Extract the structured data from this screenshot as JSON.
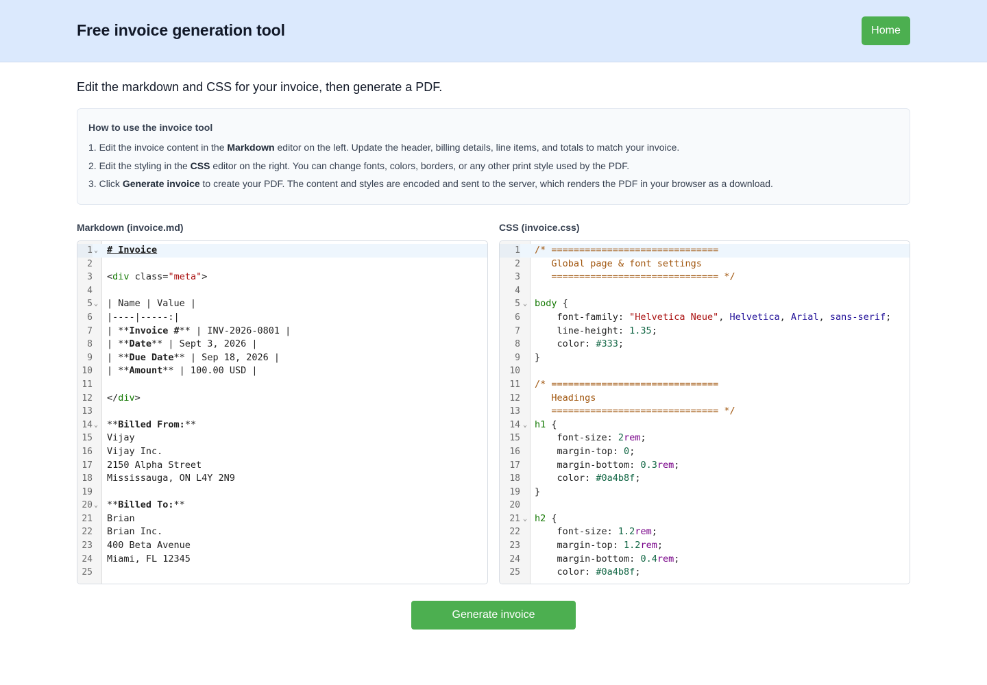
{
  "header": {
    "title": "Free invoice generation tool",
    "home_label": "Home"
  },
  "intro": "Edit the markdown and CSS for your invoice, then generate a PDF.",
  "instructions": {
    "title": "How to use the invoice tool",
    "steps": [
      {
        "n": "1. ",
        "pre": "Edit the invoice content in the ",
        "bold": "Markdown",
        "post": " editor on the left. Update the header, billing details, line items, and totals to match your invoice."
      },
      {
        "n": "2. ",
        "pre": "Edit the styling in the ",
        "bold": "CSS",
        "post": " editor on the right. You can change fonts, colors, borders, or any other print style used by the PDF."
      },
      {
        "n": "3. ",
        "pre": "Click ",
        "bold": "Generate invoice",
        "post": " to create your PDF. The content and styles are encoded and sent to the server, which renders the PDF in your browser as a download."
      }
    ]
  },
  "markdown_editor": {
    "label": "Markdown (invoice.md)",
    "lines": [
      {
        "fold": true,
        "active": true,
        "tokens": [
          [
            "head",
            "# Invoice"
          ]
        ]
      },
      {
        "tokens": []
      },
      {
        "tokens": [
          [
            "",
            "<"
          ],
          [
            "tag",
            "div"
          ],
          [
            "",
            " class="
          ],
          [
            "str",
            "\"meta\""
          ],
          [
            "",
            ">"
          ]
        ]
      },
      {
        "tokens": []
      },
      {
        "fold": true,
        "tokens": [
          [
            "",
            "| Name | Value |"
          ]
        ]
      },
      {
        "tokens": [
          [
            "",
            "|----|-----:|"
          ]
        ]
      },
      {
        "tokens": [
          [
            "",
            "| **"
          ],
          [
            "bold",
            "Invoice #"
          ],
          [
            "",
            "** | INV-2026-0801 |"
          ]
        ]
      },
      {
        "tokens": [
          [
            "",
            "| **"
          ],
          [
            "bold",
            "Date"
          ],
          [
            "",
            "** | Sept 3, 2026 |"
          ]
        ]
      },
      {
        "tokens": [
          [
            "",
            "| **"
          ],
          [
            "bold",
            "Due Date"
          ],
          [
            "",
            "** | Sep 18, 2026 |"
          ]
        ]
      },
      {
        "tokens": [
          [
            "",
            "| **"
          ],
          [
            "bold",
            "Amount"
          ],
          [
            "",
            "** | 100.00 USD |"
          ]
        ]
      },
      {
        "tokens": []
      },
      {
        "tokens": [
          [
            "",
            "</"
          ],
          [
            "tag",
            "div"
          ],
          [
            "",
            ">"
          ]
        ]
      },
      {
        "tokens": []
      },
      {
        "fold": true,
        "tokens": [
          [
            "",
            "**"
          ],
          [
            "bold",
            "Billed From:"
          ],
          [
            "",
            "**"
          ]
        ]
      },
      {
        "tokens": [
          [
            "",
            "Vijay"
          ]
        ]
      },
      {
        "tokens": [
          [
            "",
            "Vijay Inc."
          ]
        ]
      },
      {
        "tokens": [
          [
            "",
            "2150 Alpha Street"
          ]
        ]
      },
      {
        "tokens": [
          [
            "",
            "Mississauga, ON L4Y 2N9"
          ]
        ]
      },
      {
        "tokens": []
      },
      {
        "fold": true,
        "tokens": [
          [
            "",
            "**"
          ],
          [
            "bold",
            "Billed To:"
          ],
          [
            "",
            "**"
          ]
        ]
      },
      {
        "tokens": [
          [
            "",
            "Brian"
          ]
        ]
      },
      {
        "tokens": [
          [
            "",
            "Brian Inc."
          ]
        ]
      },
      {
        "tokens": [
          [
            "",
            "400 Beta Avenue"
          ]
        ]
      },
      {
        "tokens": [
          [
            "",
            "Miami, FL 12345"
          ]
        ]
      },
      {
        "tokens": []
      }
    ]
  },
  "css_editor": {
    "label": "CSS (invoice.css)",
    "lines": [
      {
        "active": true,
        "tokens": [
          [
            "cmt",
            "/* =============================="
          ]
        ]
      },
      {
        "tokens": [
          [
            "cmt",
            "   Global page & font settings"
          ]
        ]
      },
      {
        "tokens": [
          [
            "cmt",
            "   ============================== */"
          ]
        ]
      },
      {
        "tokens": []
      },
      {
        "fold": true,
        "tokens": [
          [
            "sel",
            "body"
          ],
          [
            "",
            " {"
          ]
        ]
      },
      {
        "tokens": [
          [
            "",
            "    font-family: "
          ],
          [
            "str",
            "\"Helvetica Neue\""
          ],
          [
            "",
            ", "
          ],
          [
            "kw",
            "Helvetica"
          ],
          [
            "",
            ", "
          ],
          [
            "kw",
            "Arial"
          ],
          [
            "",
            ", "
          ],
          [
            "kw",
            "sans-serif"
          ],
          [
            "",
            ";"
          ]
        ]
      },
      {
        "tokens": [
          [
            "",
            "    line-height: "
          ],
          [
            "num",
            "1.35"
          ],
          [
            "",
            ";"
          ]
        ]
      },
      {
        "tokens": [
          [
            "",
            "    color: "
          ],
          [
            "num",
            "#333"
          ],
          [
            "",
            ";"
          ]
        ]
      },
      {
        "tokens": [
          [
            "",
            "}"
          ]
        ]
      },
      {
        "tokens": []
      },
      {
        "tokens": [
          [
            "cmt",
            "/* =============================="
          ]
        ]
      },
      {
        "tokens": [
          [
            "cmt",
            "   Headings"
          ]
        ]
      },
      {
        "tokens": [
          [
            "cmt",
            "   ============================== */"
          ]
        ]
      },
      {
        "fold": true,
        "tokens": [
          [
            "sel",
            "h1"
          ],
          [
            "",
            " {"
          ]
        ]
      },
      {
        "tokens": [
          [
            "",
            "    font-size: "
          ],
          [
            "num",
            "2"
          ],
          [
            "unit",
            "rem"
          ],
          [
            "",
            ";"
          ]
        ]
      },
      {
        "tokens": [
          [
            "",
            "    margin-top: "
          ],
          [
            "num",
            "0"
          ],
          [
            "",
            ";"
          ]
        ]
      },
      {
        "tokens": [
          [
            "",
            "    margin-bottom: "
          ],
          [
            "num",
            "0.3"
          ],
          [
            "unit",
            "rem"
          ],
          [
            "",
            ";"
          ]
        ]
      },
      {
        "tokens": [
          [
            "",
            "    color: "
          ],
          [
            "num",
            "#0a4b8f"
          ],
          [
            "",
            ";"
          ]
        ]
      },
      {
        "tokens": [
          [
            "",
            "}"
          ]
        ]
      },
      {
        "tokens": []
      },
      {
        "fold": true,
        "tokens": [
          [
            "sel",
            "h2"
          ],
          [
            "",
            " {"
          ]
        ]
      },
      {
        "tokens": [
          [
            "",
            "    font-size: "
          ],
          [
            "num",
            "1.2"
          ],
          [
            "unit",
            "rem"
          ],
          [
            "",
            ";"
          ]
        ]
      },
      {
        "tokens": [
          [
            "",
            "    margin-top: "
          ],
          [
            "num",
            "1.2"
          ],
          [
            "unit",
            "rem"
          ],
          [
            "",
            ";"
          ]
        ]
      },
      {
        "tokens": [
          [
            "",
            "    margin-bottom: "
          ],
          [
            "num",
            "0.4"
          ],
          [
            "unit",
            "rem"
          ],
          [
            "",
            ";"
          ]
        ]
      },
      {
        "tokens": [
          [
            "",
            "    color: "
          ],
          [
            "num",
            "#0a4b8f"
          ],
          [
            "",
            ";"
          ]
        ]
      }
    ]
  },
  "generate_label": "Generate invoice",
  "colors": {
    "header_bg": "#dbe9fd",
    "accent_green": "#4caf50"
  }
}
